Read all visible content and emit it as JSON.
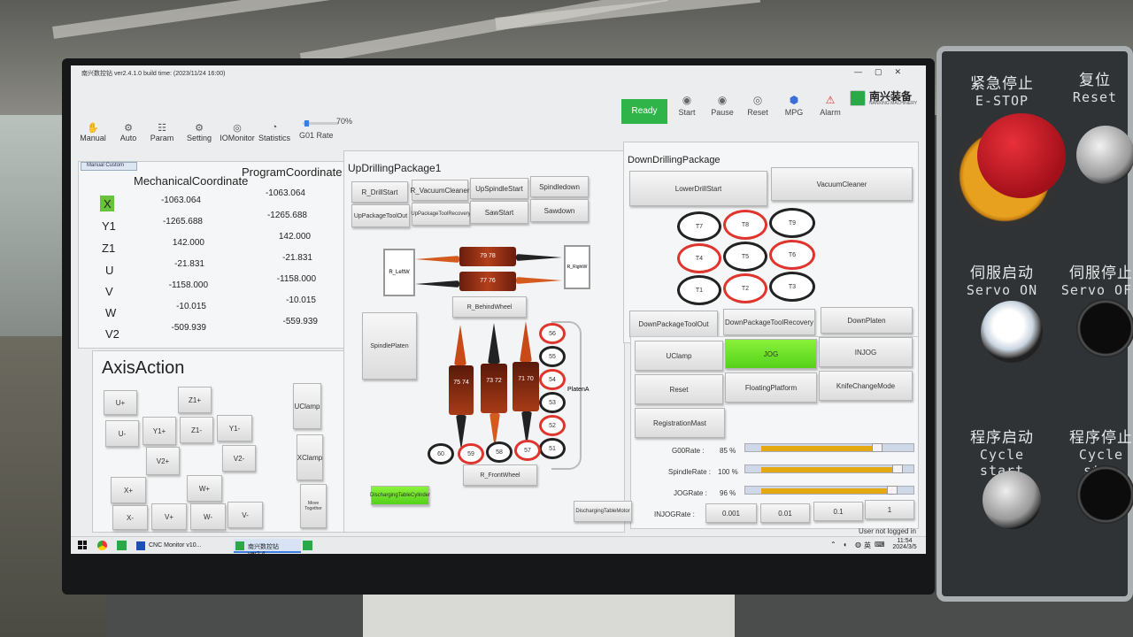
{
  "window": {
    "title": "南兴数控钻 ver2.4.1.0 build time: (2023/11/24 16:00)",
    "controls": [
      "—",
      "▢",
      "✕"
    ]
  },
  "menu": [
    {
      "label": "Manual",
      "icon": "hand-icon"
    },
    {
      "label": "Auto",
      "icon": "auto-icon"
    },
    {
      "label": "Param",
      "icon": "param-icon"
    },
    {
      "label": "Setting",
      "icon": "gear-icon"
    },
    {
      "label": "IOMonitor",
      "icon": "io-icon"
    },
    {
      "label": "Statistics",
      "icon": "stats-icon"
    }
  ],
  "rate": {
    "label": "G01 Rate",
    "value": "70%",
    "fraction": 0.7
  },
  "status": {
    "label": "Ready",
    "color": "#2fb44a"
  },
  "actions": [
    {
      "label": "Start",
      "icon": "start-icon"
    },
    {
      "label": "Pause",
      "icon": "pause-icon"
    },
    {
      "label": "Reset",
      "icon": "reset-icon"
    },
    {
      "label": "MPG",
      "icon": "mpg-icon"
    },
    {
      "label": "Alarm",
      "icon": "alarm-icon"
    }
  ],
  "brand": {
    "name": "南兴装备",
    "sub": "NANXING MACHINERY"
  },
  "tabs": {
    "label": "Manual Custom"
  },
  "coords": {
    "headers": [
      "MechanicalCoordinate",
      "ProgramCoordinate"
    ],
    "rows": [
      {
        "axis": "X",
        "mech": "-1063.064",
        "prog": "-1063.064"
      },
      {
        "axis": "Y1",
        "mech": "-1265.688",
        "prog": "-1265.688"
      },
      {
        "axis": "Z1",
        "mech": "142.000",
        "prog": "142.000"
      },
      {
        "axis": "U",
        "mech": "-21.831",
        "prog": "-21.831"
      },
      {
        "axis": "V",
        "mech": "-1158.000",
        "prog": "-1158.000"
      },
      {
        "axis": "W",
        "mech": "-10.015",
        "prog": "-10.015"
      },
      {
        "axis": "V2",
        "mech": "-509.939",
        "prog": "-559.939"
      }
    ]
  },
  "axisAction": {
    "title": "AxisAction",
    "buttons": [
      "U+",
      "Z1+",
      "U-",
      "Y1+",
      "Z1-",
      "Y1-",
      "V2+",
      "V2-",
      "X+",
      "W+",
      "X-",
      "V+",
      "W-",
      "V-"
    ],
    "side": [
      "UClamp",
      "XClamp",
      "Move Together"
    ]
  },
  "upDrill": {
    "title": "UpDrillingPackage1",
    "buttons": [
      "R_DrillStart",
      "R_VacuumCleaner",
      "UpSpindleStart",
      "Spindledown",
      "UpPackageToolOut",
      "UpPackageToolRecovery",
      "SawStart",
      "Sawdown"
    ],
    "spindlePlaten": "SpindlePlaten",
    "leftW": "R_LeftW",
    "rightW": "R_RightW",
    "behindWheel": "R_BehindWheel",
    "frontWheel": "R_FrontWheel",
    "platenA": "PlatenA",
    "discharge": "DischargingTableCylinder",
    "drillLabels": [
      "79 78",
      "77 76"
    ],
    "vertLabels": [
      "75 74",
      "73 72",
      "71 70"
    ],
    "stack": [
      "56",
      "55",
      "54",
      "53",
      "52",
      "51"
    ],
    "bottom": [
      "60",
      "59",
      "58",
      "57"
    ]
  },
  "downDrill": {
    "title": "DownDrillingPackage",
    "buttons": [
      "LowerDrillStart",
      "VacuumCleaner"
    ],
    "tools": [
      "T7",
      "T8",
      "T9",
      "T4",
      "T5",
      "T6",
      "T1",
      "T2",
      "T3"
    ],
    "row": [
      "DownPackageToolOut",
      "DownPackageToolRecovery",
      "DownPlaten"
    ]
  },
  "controlGrid": [
    "UClamp",
    "JOG",
    "INJOG",
    "Reset",
    "FloatingPlatform",
    "KnifeChangeMode",
    "RegistrationMast"
  ],
  "rates": [
    {
      "label": "G00Rate :",
      "value": "85 %",
      "fraction": 0.85
    },
    {
      "label": "SpindleRate :",
      "value": "100 %",
      "fraction": 1.0
    },
    {
      "label": "JOGRate :",
      "value": "96 %",
      "fraction": 0.96
    }
  ],
  "injog": {
    "label": "INJOGRate :",
    "options": [
      "0.001",
      "0.01",
      "0.1",
      "1"
    ]
  },
  "dischargingMotor": "DischargingTableMotor",
  "login": "User not logged in",
  "taskbar": {
    "items": [
      "CNC Monitor v10...",
      "南兴数控钻 ver2.4..."
    ],
    "time": "11:54",
    "date": "2024/3/5",
    "lang": "英"
  },
  "panel": [
    {
      "cn": "紧急停止",
      "en": "E-STOP"
    },
    {
      "cn": "复位",
      "en": "Reset"
    },
    {
      "cn": "伺服启动",
      "en": "Servo ON"
    },
    {
      "cn": "伺服停止",
      "en": "Servo OFF"
    },
    {
      "cn": "程序启动",
      "en": "Cycle start"
    },
    {
      "cn": "程序停止",
      "en": "Cycle stop"
    }
  ]
}
